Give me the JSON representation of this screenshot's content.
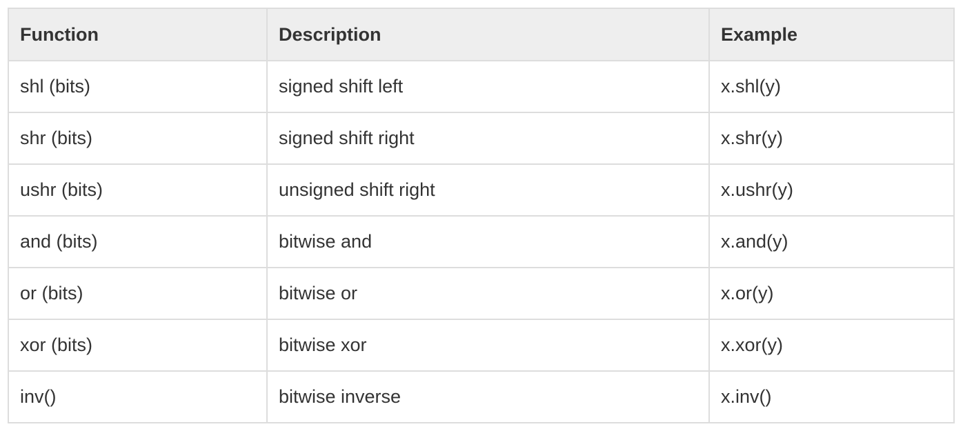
{
  "headers": [
    "Function",
    "Description",
    "Example"
  ],
  "rows": [
    [
      "shl (bits)",
      "signed shift left",
      "x.shl(y)"
    ],
    [
      "shr (bits)",
      "signed shift right",
      "x.shr(y)"
    ],
    [
      "ushr (bits)",
      "unsigned shift right",
      "x.ushr(y)"
    ],
    [
      "and (bits)",
      "bitwise and",
      "x.and(y)"
    ],
    [
      "or (bits)",
      "bitwise or",
      "x.or(y)"
    ],
    [
      "xor (bits)",
      "bitwise xor",
      "x.xor(y)"
    ],
    [
      "inv()",
      "bitwise inverse",
      "x.inv()"
    ]
  ]
}
